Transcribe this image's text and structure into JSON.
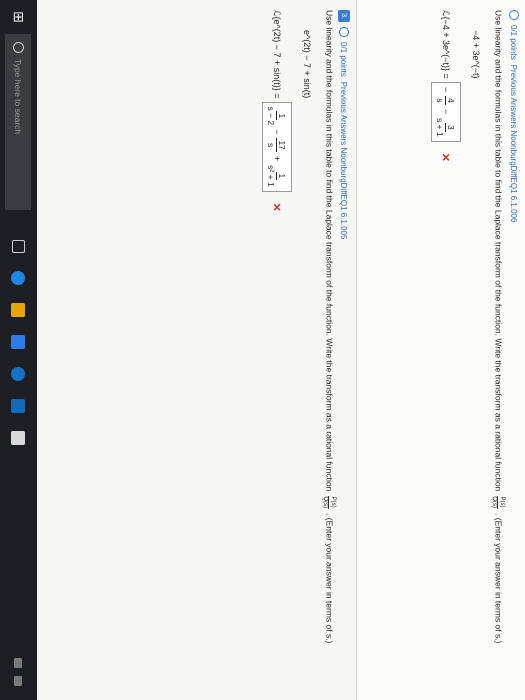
{
  "question1": {
    "points": "0/1 points",
    "source": "Previous Answers  NoonburgDiffEQ1 6.1.006",
    "instruction": "Use linearity and the formulas in this table to find the Laplace transform of the function. Write the transform as a rational function",
    "ratio_num": "P(s)",
    "ratio_den": "Q(s)",
    "instruction_tail": ". (Enter your answer in terms of s.)",
    "function": "−4 + 3e^(−t)",
    "lhs": "ℒ{−4 + 3e^(−t)} =",
    "answer": {
      "term1_num": "4",
      "term1_den": "s",
      "op": "−",
      "term2_num": "3",
      "term2_den": "s + 1",
      "sign_prefix": "−"
    },
    "result_mark": "✕"
  },
  "question2": {
    "number": "3.",
    "points": "0/1 points",
    "source": "Previous Answers  NoonburgDiffEQ1 6.1.005",
    "instruction": "Use linearity and the formulas in this table to find the Laplace transform of the function. Write the transform as a rational function",
    "ratio_num": "P(s)",
    "ratio_den": "Q(s)",
    "instruction_tail": ". (Enter your answer in terms of s.)",
    "function": "e^(2t) − 7 + sin(t)",
    "lhs": "ℒ{e^(2t) − 7 + sin(t)} =",
    "answer": {
      "t1_num": "1",
      "t1_den": "s − 2",
      "op1": "−",
      "t2_num": "17",
      "t2_den": "s",
      "op2": "+",
      "t3_num": "1",
      "t3_den": "s² + 1"
    },
    "result_mark": "✕"
  },
  "taskbar": {
    "search_placeholder": "Type here to search"
  },
  "colors": {
    "accent": "#3a7bd5",
    "wrong": "#d0342c"
  }
}
